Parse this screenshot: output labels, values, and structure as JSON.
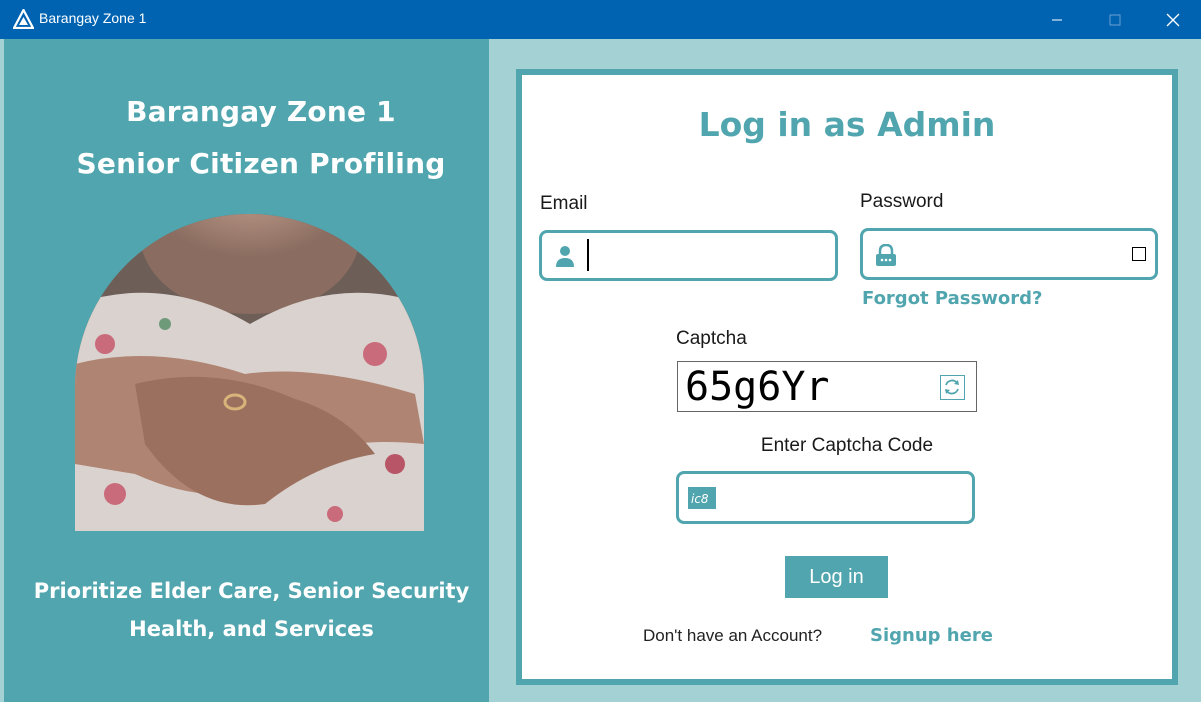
{
  "window": {
    "title": "Barangay Zone 1"
  },
  "left_panel": {
    "title_line1": "Barangay Zone 1",
    "title_line2": "Senior Citizen Profiling",
    "tagline_line1": "Prioritize Elder Care, Senior Security",
    "tagline_line2": "Health, and Services"
  },
  "form": {
    "heading": "Log in as Admin",
    "email_label": "Email",
    "email_value": "",
    "password_label": "Password",
    "password_value": "",
    "forgot_password": "Forgot Password?",
    "captcha_label": "Captcha",
    "captcha_code": "65g6Yr",
    "enter_captcha_label": "Enter Captcha Code",
    "captcha_input_value": "",
    "login_button": "Log in",
    "no_account_text": "Don't have an Account?",
    "signup_link": "Signup here"
  },
  "colors": {
    "accent": "#50a5ae",
    "titlebar": "#0063b1",
    "background": "#a3d1d4"
  }
}
